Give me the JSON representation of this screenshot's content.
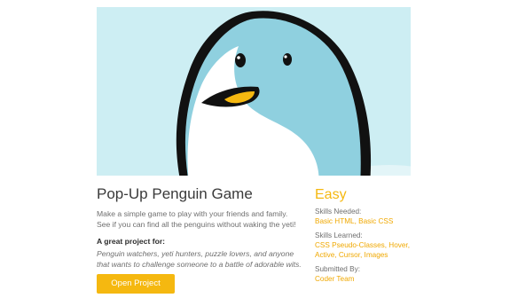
{
  "project": {
    "title": "Pop-Up Penguin Game",
    "description": "Make a simple game to play with your friends and family. See if you can find all the penguins without waking the yeti!",
    "great_for_label": "A great project for:",
    "great_for_text": "Penguin watchers, yeti hunters, puzzle lovers, and anyone that wants to challenge someone to a battle of adorable wits.",
    "open_button": "Open Project"
  },
  "details": {
    "level": "Easy",
    "skills_needed_label": "Skills Needed:",
    "skills_needed": [
      "Basic HTML",
      "Basic CSS"
    ],
    "skills_learned_label": "Skills Learned:",
    "skills_learned": [
      "CSS Pseudo-Classes",
      "Hover",
      "Active",
      "Cursor",
      "Images"
    ],
    "submitted_by_label": "Submitted By:",
    "submitted_by": "Coder Team"
  },
  "colors": {
    "accent": "#f5b810",
    "hero_bg": "#cdeef3",
    "penguin_head": "#8fd0df",
    "beak": "#f5b810"
  },
  "hero_image": {
    "icon": "penguin-illustration"
  }
}
